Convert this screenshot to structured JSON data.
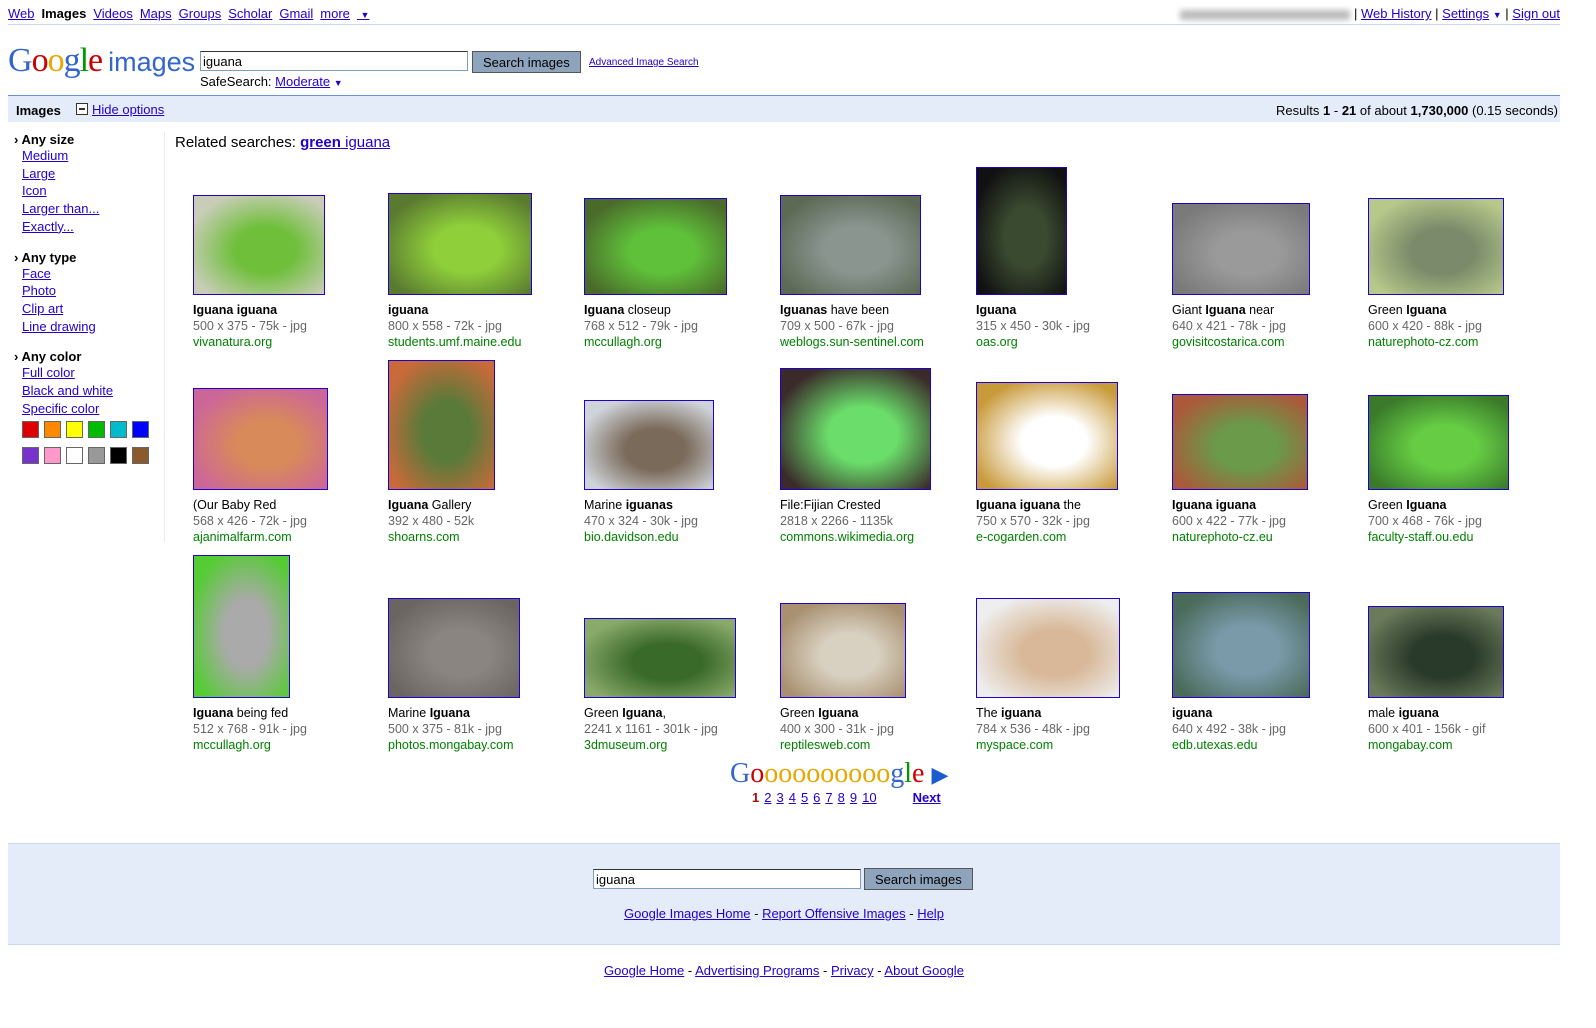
{
  "nav": {
    "items": [
      "Web",
      "Images",
      "Videos",
      "Maps",
      "Groups",
      "Scholar",
      "Gmail",
      "more"
    ],
    "active": "Images",
    "right": [
      "Web History",
      "Settings",
      "Sign out"
    ]
  },
  "logo": {
    "text": "Google",
    "suffix": "images"
  },
  "search": {
    "value": "iguana",
    "button": "Search images",
    "advanced": "Advanced Image Search",
    "safesearch_label": "SafeSearch:",
    "safesearch_value": "Moderate"
  },
  "bar": {
    "title": "Images",
    "hide_options": "Hide options",
    "results_prefix": "Results",
    "from": "1",
    "to": "21",
    "of_about": "of about",
    "total": "1,730,000",
    "time": "(0.15 seconds)"
  },
  "sidebar": {
    "size": {
      "heading": "Any size",
      "items": [
        "Medium",
        "Large",
        "Icon",
        "Larger than...",
        "Exactly..."
      ]
    },
    "type": {
      "heading": "Any type",
      "items": [
        "Face",
        "Photo",
        "Clip art",
        "Line drawing"
      ]
    },
    "color": {
      "heading": "Any color",
      "items": [
        "Full color",
        "Black and white",
        "Specific color"
      ],
      "swatches": [
        "#dd0000",
        "#ff8800",
        "#ffff00",
        "#00bb00",
        "#00bbcc",
        "#0000ff",
        "#7733cc",
        "#ff99cc",
        "#ffffff",
        "#999999",
        "#000000",
        "#8b5a2b"
      ]
    }
  },
  "related": {
    "label": "Related searches:",
    "bold": "green",
    "rest": " iguana"
  },
  "results": [
    {
      "t": [
        [
          "Iguana iguana",
          1
        ]
      ],
      "d": "500 x 375 - 75k - jpg",
      "s": "vivanatura.org"
    },
    {
      "t": [
        [
          "iguana",
          1
        ]
      ],
      "d": "800 x 558 - 72k - jpg",
      "s": "students.umf.maine.edu"
    },
    {
      "t": [
        [
          "Iguana",
          1
        ],
        [
          " closeup",
          0
        ]
      ],
      "d": "768 x 512 - 79k - jpg",
      "s": "mccullagh.org"
    },
    {
      "t": [
        [
          "Iguanas",
          1
        ],
        [
          " have been",
          0
        ]
      ],
      "d": "709 x 500 - 67k - jpg",
      "s": "weblogs.sun-sentinel.com"
    },
    {
      "t": [
        [
          "Iguana",
          1
        ]
      ],
      "d": "315 x 450 - 30k - jpg",
      "s": "oas.org"
    },
    {
      "t": [
        [
          "Giant ",
          0
        ],
        [
          "Iguana",
          1
        ],
        [
          " near",
          0
        ]
      ],
      "d": "640 x 421 - 78k - jpg",
      "s": "govisitcostarica.com"
    },
    {
      "t": [
        [
          "Green ",
          0
        ],
        [
          "Iguana",
          1
        ]
      ],
      "d": "600 x 420 - 88k - jpg",
      "s": "naturephoto-cz.com"
    },
    {
      "t": [
        [
          "(Our Baby Red",
          0
        ]
      ],
      "d": "568 x 426 - 72k - jpg",
      "s": "ajanimalfarm.com"
    },
    {
      "t": [
        [
          "Iguana",
          1
        ],
        [
          " Gallery",
          0
        ]
      ],
      "d": "392 x 480 - 52k",
      "s": "shoarns.com"
    },
    {
      "t": [
        [
          "Marine ",
          0
        ],
        [
          "iguanas",
          1
        ]
      ],
      "d": "470 x 324 - 30k - jpg",
      "s": "bio.davidson.edu"
    },
    {
      "t": [
        [
          "File:Fijian Crested",
          0
        ]
      ],
      "d": "2818 x 2266 - 1135k",
      "s": "commons.wikimedia.org"
    },
    {
      "t": [
        [
          "Iguana iguana",
          1
        ],
        [
          " the",
          0
        ]
      ],
      "d": "750 x 570 - 32k - jpg",
      "s": "e-cogarden.com"
    },
    {
      "t": [
        [
          "Iguana iguana",
          1
        ]
      ],
      "d": "600 x 422 - 77k - jpg",
      "s": "naturephoto-cz.eu"
    },
    {
      "t": [
        [
          "Green ",
          0
        ],
        [
          "Iguana",
          1
        ]
      ],
      "d": "700 x 468 - 76k - jpg",
      "s": "faculty-staff.ou.edu"
    },
    {
      "t": [
        [
          "Iguana",
          1
        ],
        [
          " being fed",
          0
        ]
      ],
      "d": "512 x 768 - 91k - jpg",
      "s": "mccullagh.org"
    },
    {
      "t": [
        [
          "Marine ",
          0
        ],
        [
          "Iguana",
          1
        ]
      ],
      "d": "500 x 375 - 81k - jpg",
      "s": "photos.mongabay.com"
    },
    {
      "t": [
        [
          "Green ",
          0
        ],
        [
          "Iguana",
          1
        ],
        [
          ",",
          0
        ]
      ],
      "d": "2241 x 1161 - 301k - jpg",
      "s": "3dmuseum.org"
    },
    {
      "t": [
        [
          "Green ",
          0
        ],
        [
          "Iguana",
          1
        ]
      ],
      "d": "400 x 300 - 31k - jpg",
      "s": "reptilesweb.com"
    },
    {
      "t": [
        [
          "The ",
          0
        ],
        [
          "iguana",
          1
        ]
      ],
      "d": "784 x 536 - 48k - jpg",
      "s": "myspace.com"
    },
    {
      "t": [
        [
          "iguana",
          1
        ]
      ],
      "d": "640 x 492 - 38k - jpg",
      "s": "edb.utexas.edu"
    },
    {
      "t": [
        [
          "male ",
          0
        ],
        [
          "iguana",
          1
        ]
      ],
      "d": "600 x 401 - 156k - gif",
      "s": "mongabay.com"
    }
  ],
  "pagination": {
    "current": "1",
    "pages": [
      "2",
      "3",
      "4",
      "5",
      "6",
      "7",
      "8",
      "9",
      "10"
    ],
    "next": "Next"
  },
  "footer": {
    "links": [
      "Google Images Home",
      "Report Offensive Images",
      "Help"
    ],
    "links2": [
      "Google Home",
      "Advertising Programs",
      "Privacy",
      "About Google"
    ]
  }
}
